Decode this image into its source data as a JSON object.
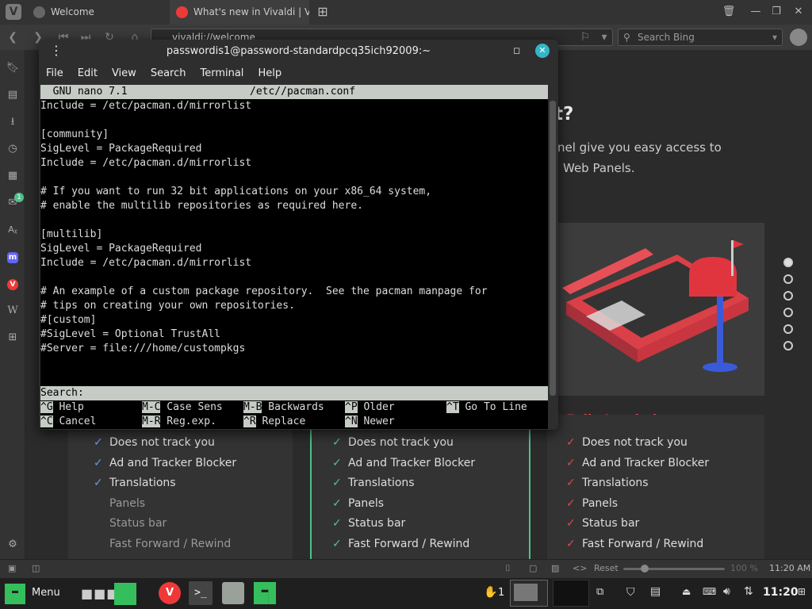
{
  "browser": {
    "tabs": [
      {
        "label": "Welcome"
      },
      {
        "label": "What's new in Vivaldi | Viva"
      }
    ],
    "url": "vivaldi://welcome",
    "search_placeholder": "Search Bing",
    "side_panel_badge": "1"
  },
  "page": {
    "heading_fragment": "t?",
    "text_line1": "nel give you easy access to",
    "text_line2": "Web Panels.",
    "plan_title": "Fully Loaded",
    "columns": [
      {
        "features": [
          "Does not track you",
          "Ad and Tracker Blocker",
          "Translations",
          "Panels",
          "Status bar",
          "Fast Forward / Rewind"
        ],
        "checked_count": 3
      },
      {
        "features": [
          "Does not track you",
          "Ad and Tracker Blocker",
          "Translations",
          "Panels",
          "Status bar",
          "Fast Forward / Rewind"
        ],
        "checked_count": 6
      },
      {
        "features": [
          "Does not track you",
          "Ad and Tracker Blocker",
          "Translations",
          "Panels",
          "Status bar",
          "Fast Forward / Rewind"
        ],
        "checked_count": 6
      }
    ],
    "colors": {
      "blue_check": "#6d9be0",
      "green_check": "#5bbf8a",
      "red_check": "#e0484e",
      "red_title": "#ef4a52",
      "green_border": "#4fc08d"
    }
  },
  "statusbar": {
    "reset_label": "Reset",
    "zoom": "100 %",
    "time": "11:20 AM"
  },
  "terminal": {
    "title": "passwordis1@password-standardpcq35ich92009:~",
    "menu": [
      "File",
      "Edit",
      "View",
      "Search",
      "Terminal",
      "Help"
    ],
    "nano_header_left": "  GNU nano 7.1",
    "nano_header_file": "/etc//pacman.conf",
    "lines": [
      "Include = /etc/pacman.d/mirrorlist",
      "",
      "[community]",
      "SigLevel = PackageRequired",
      "Include = /etc/pacman.d/mirrorlist",
      "",
      "# If you want to run 32 bit applications on your x86_64 system,",
      "# enable the multilib repositories as required here.",
      "",
      "[multilib]",
      "SigLevel = PackageRequired",
      "Include = /etc/pacman.d/mirrorlist",
      "",
      "# An example of a custom package repository.  See the pacman manpage for",
      "# tips on creating your own repositories.",
      "#[custom]",
      "#SigLevel = Optional TrustAll",
      "#Server = file:///home/custompkgs",
      "",
      ""
    ],
    "search_prompt": "Search:",
    "shortcuts_row1": [
      {
        "key": "^G",
        "label": " Help"
      },
      {
        "key": "M-C",
        "label": " Case Sens"
      },
      {
        "key": "M-B",
        "label": " Backwards"
      },
      {
        "key": "^P",
        "label": " Older"
      },
      {
        "key": "^T",
        "label": " Go To Line"
      }
    ],
    "shortcuts_row2": [
      {
        "key": "^C",
        "label": " Cancel"
      },
      {
        "key": "M-R",
        "label": " Reg.exp."
      },
      {
        "key": "^R",
        "label": " Replace"
      },
      {
        "key": "^N",
        "label": " Newer"
      }
    ]
  },
  "taskbar": {
    "menu_label": "Menu",
    "notification_count": "1",
    "time": "11:20"
  }
}
